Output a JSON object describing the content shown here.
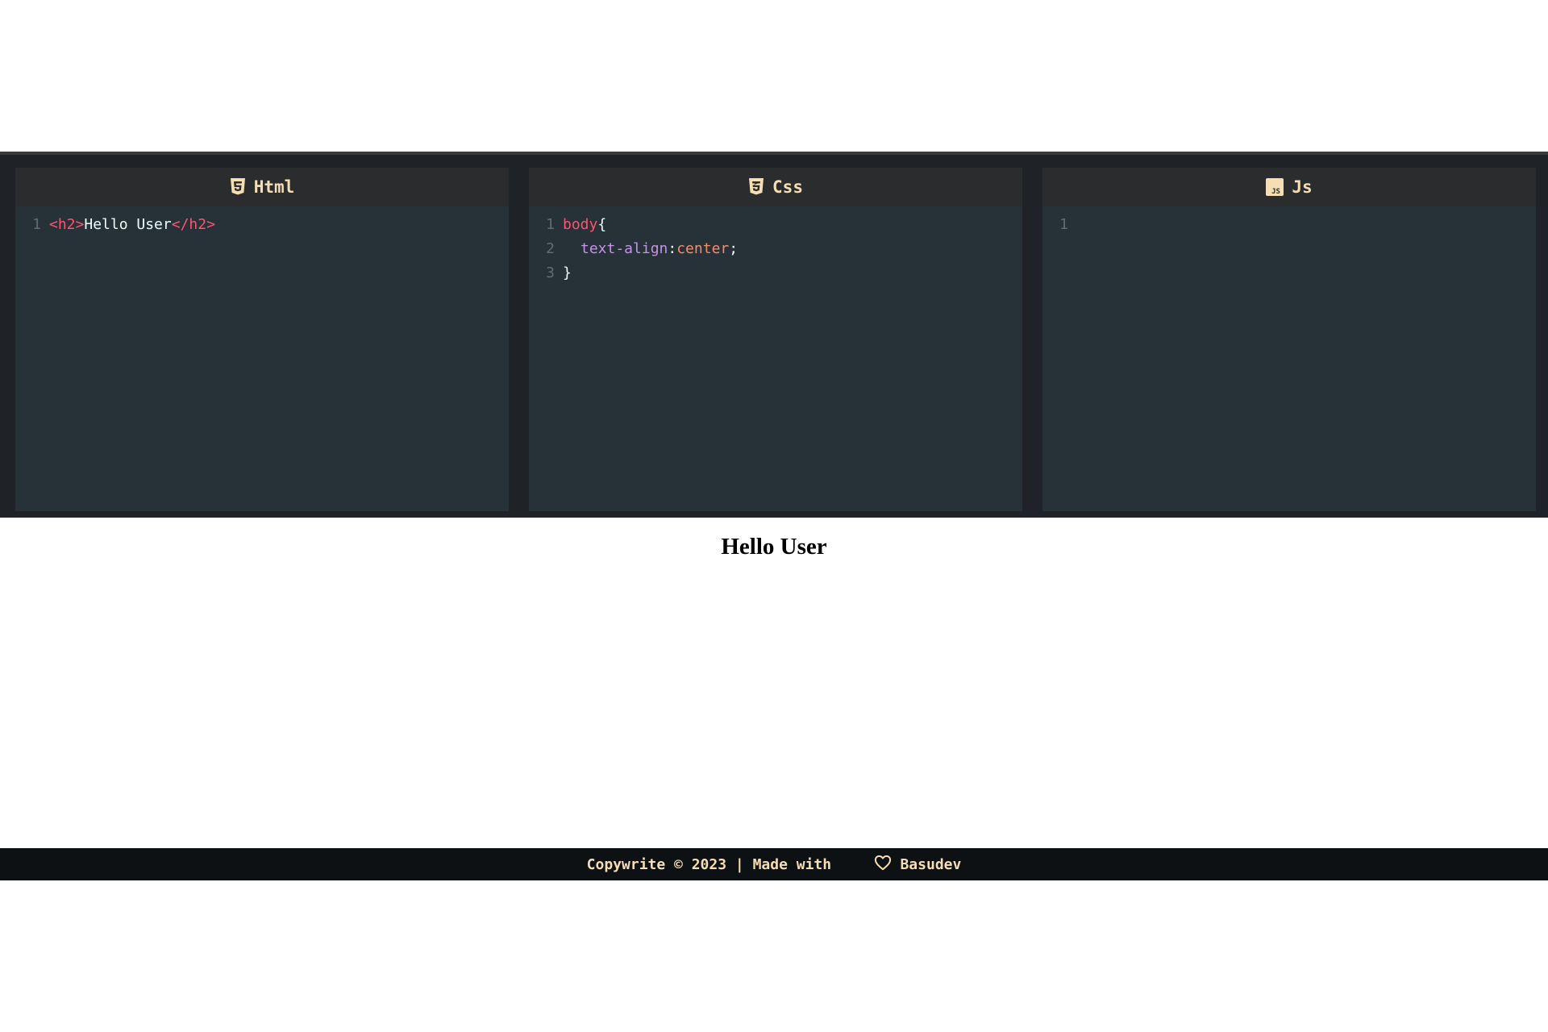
{
  "editors": {
    "html": {
      "title": "Html",
      "icon": "html5-icon",
      "lines": [
        {
          "number": "1",
          "open_tag": "<h2>",
          "text": "Hello User",
          "close_tag": "</h2>"
        }
      ]
    },
    "css": {
      "title": "Css",
      "icon": "css3-icon",
      "lines": [
        {
          "number": "1",
          "selector": "body",
          "open_brace": "{"
        },
        {
          "number": "2",
          "property": "text-align",
          "colon": ":",
          "value": "center",
          "semicolon": ";"
        },
        {
          "number": "3",
          "close_brace": "}"
        }
      ]
    },
    "js": {
      "title": "Js",
      "icon": "javascript-icon",
      "lines": [
        {
          "number": "1"
        }
      ]
    }
  },
  "output": {
    "heading": "Hello User"
  },
  "footer": {
    "text_before": "Copywrite © 2023 | Made with",
    "icon": "heart-icon",
    "text_after": "Basudev"
  },
  "colors": {
    "tag": "#ff5370",
    "property": "#c792ea",
    "value": "#f78c6c",
    "header_text": "#f5deb3",
    "editor_bg": "#263238"
  }
}
